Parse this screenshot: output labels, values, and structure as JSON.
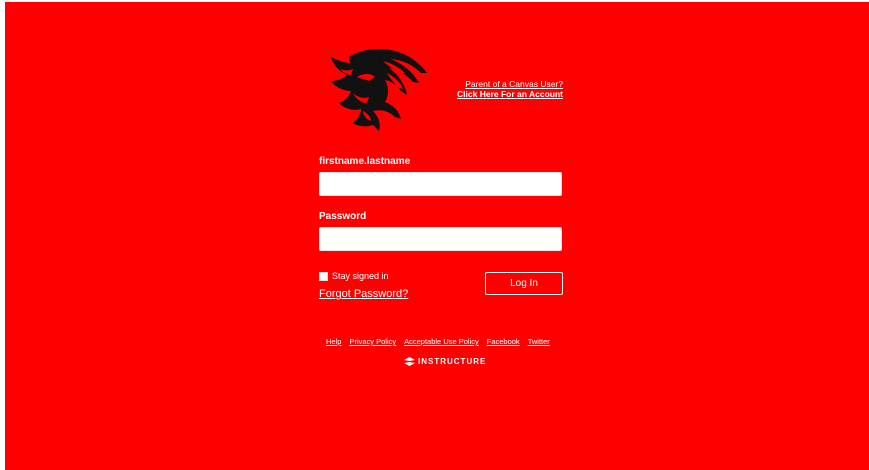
{
  "header": {
    "parent_link_line1": "Parent of a Canvas User?",
    "parent_link_line2": "Click Here For an Account"
  },
  "form": {
    "username_label": "firstname.lastname",
    "username_value": "",
    "password_label": "Password",
    "password_value": "",
    "stay_signed_in_label": "Stay signed in",
    "stay_signed_in_checked": false,
    "forgot_password_label": "Forgot Password?",
    "login_button_label": "Log In"
  },
  "footer": {
    "links": [
      "Help",
      "Privacy Policy",
      "Acceptable Use Policy",
      "Facebook",
      "Twitter"
    ],
    "brand": "INSTRUCTURE"
  },
  "colors": {
    "background": "#ff0000",
    "text": "#ffffff"
  },
  "icons": {
    "logo": "lion-head-logo",
    "brand": "instructure-logo-icon"
  }
}
